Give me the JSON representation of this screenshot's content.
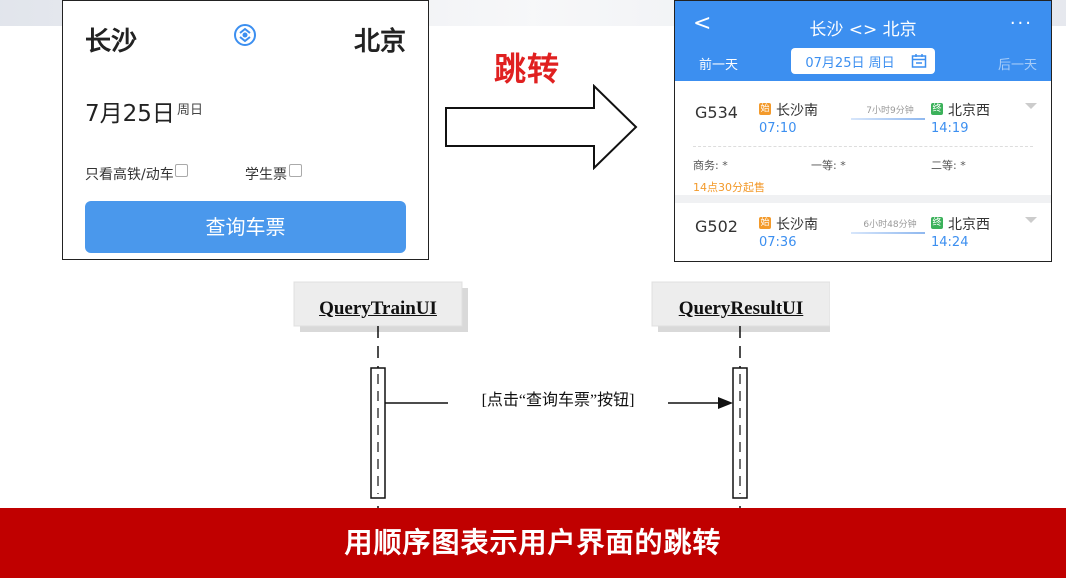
{
  "left_panel": {
    "from_city": "长沙",
    "to_city": "北京",
    "date": "7月25日",
    "weekday": "周日",
    "option_high_speed": "只看高铁/动车",
    "option_student": "学生票",
    "query_button": "查询车票"
  },
  "jump_label": "跳转",
  "right_panel": {
    "back": "<",
    "title": "长沙 <> 北京",
    "more": "···",
    "prev_day": "前一天",
    "date": "07月25日 周日",
    "next_day": "后一天",
    "trains": [
      {
        "number": "G534",
        "start_badge": "始",
        "from_station": "长沙南",
        "depart": "07:10",
        "duration": "7小时9分钟",
        "end_badge": "终",
        "to_station": "北京西",
        "arrive": "14:19",
        "seat_business": "商务: *",
        "seat_first": "一等: *",
        "seat_second": "二等: *",
        "sale_note": "14点30分起售"
      },
      {
        "number": "G502",
        "start_badge": "始",
        "from_station": "长沙南",
        "depart": "07:36",
        "duration": "6小时48分钟",
        "end_badge": "终",
        "to_station": "北京西",
        "arrive": "14:24"
      }
    ]
  },
  "diagram": {
    "object_left": "QueryTrainUI",
    "object_right": "QueryResultUI",
    "message": "[点击“查询车票”按钮]"
  },
  "banner": "用顺序图表示用户界面的跳转",
  "colors": {
    "app_blue": "#3c8ff0",
    "button_blue": "#4a98ec",
    "jump_red": "#e02020",
    "banner_red": "#c00000",
    "start_orange": "#f39a2b",
    "end_green": "#3bb15a"
  }
}
